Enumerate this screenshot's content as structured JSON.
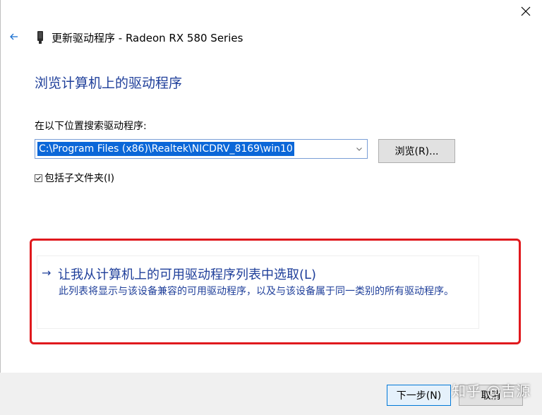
{
  "window": {
    "title": "更新驱动程序 - Radeon RX 580 Series",
    "back_icon": "arrow-left-icon",
    "close_icon": "close-icon"
  },
  "page": {
    "title": "浏览计算机上的驱动程序",
    "search_label": "在以下位置搜索驱动程序:",
    "path_value": "C:\\Program Files (x86)\\Realtek\\NICDRV_8169\\win10",
    "browse_label": "浏览(R)...",
    "include_subfolders_label": "包括子文件夹(I)",
    "include_subfolders_checked": true
  },
  "pick_option": {
    "arrow": "→",
    "title": "让我从计算机上的可用驱动程序列表中选取(L)",
    "description": "此列表将显示与该设备兼容的可用驱动程序，以及与该设备属于同一类别的所有驱动程序。"
  },
  "footer": {
    "next_label": "下一步(N)",
    "cancel_label": "取消"
  },
  "watermark": "知乎 @吉源",
  "colors": {
    "link_blue": "#1f3f9a",
    "selection_blue": "#0b67d8",
    "highlight_red": "#e0191d",
    "footer_bg": "#f0f0f0"
  }
}
